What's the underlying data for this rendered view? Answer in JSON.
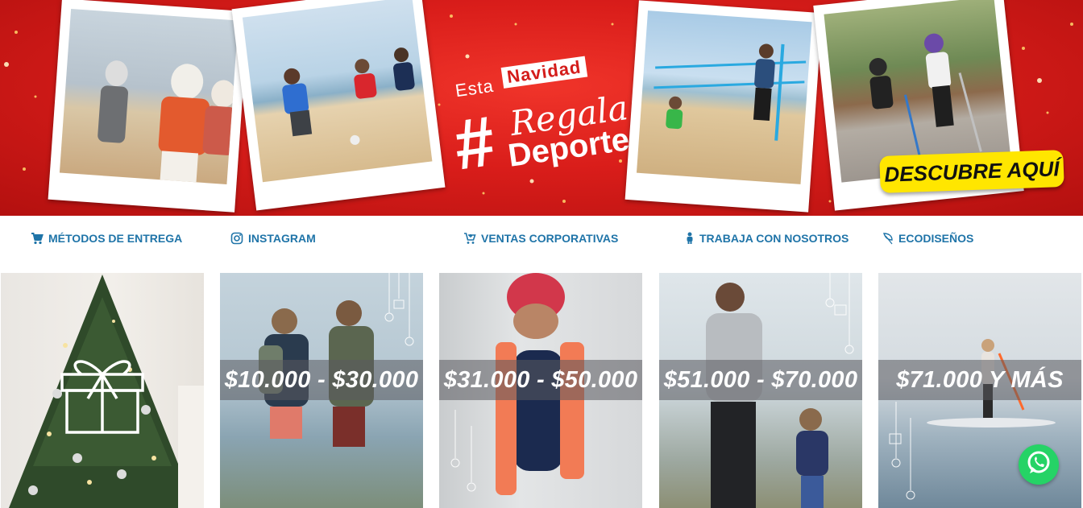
{
  "hero": {
    "slogan_esta": "Esta",
    "slogan_navidad": "Navidad",
    "slogan_hash": "#",
    "slogan_regala": "Regala",
    "slogan_deporte": "Deporte",
    "cta_label": "DESCUBRE AQUÍ",
    "accent_color": "#d91d1a",
    "cta_color": "#ffe600"
  },
  "nav": {
    "links": [
      {
        "label": "MÉTODOS DE ENTREGA",
        "icon": "cart-icon"
      },
      {
        "label": "INSTAGRAM",
        "icon": "instagram-icon"
      },
      {
        "label": "VENTAS CORPORATIVAS",
        "icon": "cart-plus-icon"
      },
      {
        "label": "TRABAJA CON NOSOTROS",
        "icon": "person-icon"
      },
      {
        "label": "ECODISEÑOS",
        "icon": "leaf-icon"
      }
    ],
    "link_color": "#1f74a8"
  },
  "tiles": [
    {
      "label": "",
      "icon": "gift-icon"
    },
    {
      "label": "$10.000 - $30.000"
    },
    {
      "label": "$31.000 - $50.000"
    },
    {
      "label": "$51.000 - $70.000"
    },
    {
      "label": "$71.000 Y MÁS"
    }
  ],
  "floating": {
    "icon": "whatsapp-icon",
    "color": "#25d366"
  }
}
